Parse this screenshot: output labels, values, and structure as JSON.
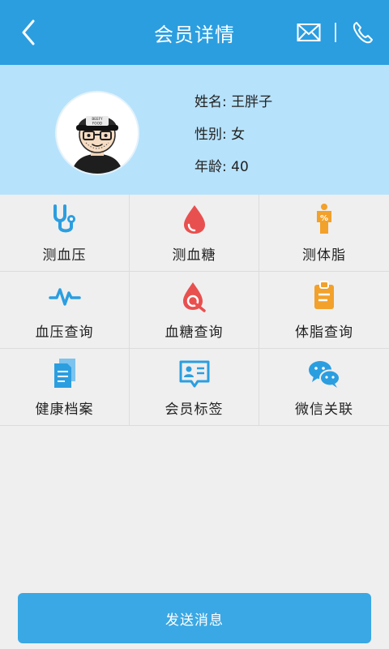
{
  "header": {
    "title": "会员详情",
    "back_icon": "chevron-left-icon",
    "mail_icon": "mail-icon",
    "phone_icon": "phone-icon"
  },
  "member": {
    "name_label": "姓名: 王胖子",
    "gender_label": "性别: 女",
    "age_label": "年龄: 40",
    "avatar_cap_text": "BEEFY\nFOOD"
  },
  "actions": [
    {
      "label": "测血压",
      "icon": "stethoscope-icon",
      "color": "#2b9ee0"
    },
    {
      "label": "测血糖",
      "icon": "blood-drop-icon",
      "color": "#e8504f"
    },
    {
      "label": "测体脂",
      "icon": "body-fat-icon",
      "color": "#f2a12b"
    },
    {
      "label": "血压查询",
      "icon": "pulse-icon",
      "color": "#2b9ee0"
    },
    {
      "label": "血糖查询",
      "icon": "blood-search-icon",
      "color": "#e8504f"
    },
    {
      "label": "体脂查询",
      "icon": "clipboard-icon",
      "color": "#f2a12b"
    },
    {
      "label": "健康档案",
      "icon": "document-icon",
      "color": "#2b9ee0"
    },
    {
      "label": "会员标签",
      "icon": "id-card-icon",
      "color": "#2b9ee0"
    },
    {
      "label": "微信关联",
      "icon": "wechat-icon",
      "color": "#2b9ee0"
    }
  ],
  "footer": {
    "send_label": "发送消息"
  },
  "colors": {
    "topbar": "#2b9ee0",
    "profile_bg": "#b7e2fb",
    "page_bg": "#efefef",
    "button": "#3aa8e4"
  }
}
